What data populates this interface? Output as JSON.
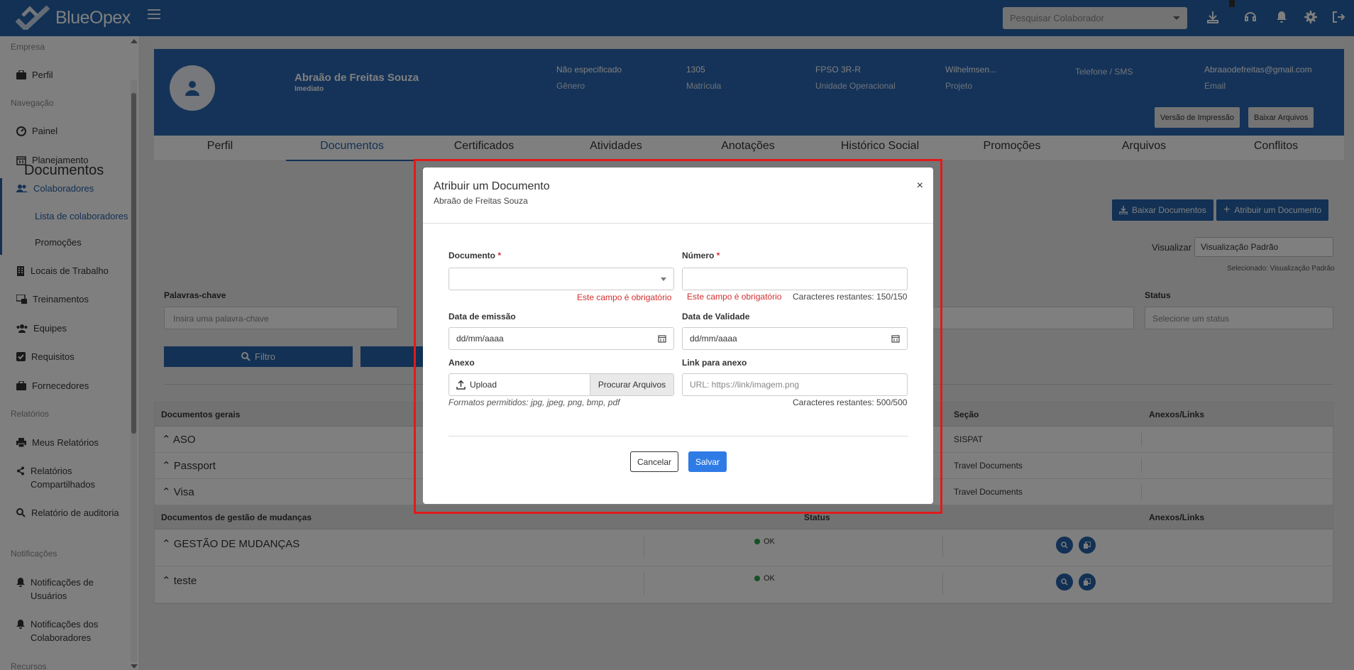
{
  "app": {
    "brand": "BlueOpex"
  },
  "topbar": {
    "search_placeholder": "Pesquisar Colaborador"
  },
  "sidebar": {
    "sections": {
      "empresa": "Empresa",
      "navegacao": "Navegação",
      "relatorios": "Relatórios",
      "notificacoes": "Notificações",
      "recursos": "Recursos"
    },
    "items": {
      "perfil": "Perfil",
      "painel": "Painel",
      "planejamento": "Planejamento",
      "colaboradores": "Colaboradores",
      "lista": "Lista de colaboradores",
      "promocoes": "Promoções",
      "locais": "Locais de Trabalho",
      "treinamentos": "Treinamentos",
      "equipes": "Equipes",
      "requisitos": "Requisitos",
      "fornecedores": "Fornecedores",
      "meus_relatorios": "Meus Relatórios",
      "relatorios_compartilhados": "Relatórios Compartilhados",
      "relatorio_auditoria": "Relatório de auditoria",
      "notif_usuarios": "Notificações de Usuários",
      "notif_colaboradores": "Notificações dos Colaboradores"
    }
  },
  "profile": {
    "name": "Abraão de Freitas Souza",
    "subtitle": "Imediato",
    "gender_value": "Não especificado",
    "gender_label": "Gênero",
    "matricula_value": "1305",
    "matricula_label": "Matrícula",
    "unit_value": "FPSO 3R-R",
    "unit_label": "Unidade Operacional",
    "project_value": "Wilhelmsen...",
    "project_label": "Projeto",
    "phone_label": "Telefone / SMS",
    "email_value": "Abraaodefreitas@gmail.com",
    "email_label": "Email",
    "print_btn": "Versão de Impressão",
    "download_btn": "Baixar Arquivos"
  },
  "tabs": [
    "Perfil",
    "Documentos",
    "Certificados",
    "Atividades",
    "Anotações",
    "Histórico Social",
    "Promoções",
    "Arquivos",
    "Conflitos"
  ],
  "documents": {
    "title": "Documentos",
    "download_btn": "Baixar Documentos",
    "assign_btn": "Atribuir um Documento",
    "visualizar_label": "Visualizar",
    "visualizar_value": "Visualização Padrão",
    "selected_note": "Selecionado: Visualização Padrão",
    "keywords_label": "Palavras-chave",
    "keywords_placeholder": "Insira uma palavra-chave",
    "status_label": "Status",
    "status_placeholder": "Selecione um status",
    "filter_btn": "Filtro"
  },
  "table1": {
    "headers": {
      "name": "Documentos gerais",
      "section": "Seção",
      "attachments": "Anexos/Links"
    },
    "rows": [
      {
        "name": "ASO",
        "section": "SISPAT"
      },
      {
        "name": "Passport",
        "section": "Travel Documents"
      },
      {
        "name": "Visa",
        "section": "Travel Documents"
      }
    ]
  },
  "table2": {
    "headers": {
      "name": "Documentos de gestão de mudanças",
      "status": "Status",
      "attachments": "Anexos/Links"
    },
    "rows": [
      {
        "name": "GESTÃO DE MUDANÇAS",
        "status": "OK"
      },
      {
        "name": "teste",
        "status": "OK"
      }
    ]
  },
  "modal": {
    "title": "Atribuir um Documento",
    "subtitle": "Abraão de Freitas Souza",
    "close": "×",
    "documento_label": "Documento",
    "numero_label": "Número",
    "required_mark": "*",
    "required_error": "Este campo é obrigatório",
    "chars_numero": "Caracteres restantes: 150/150",
    "emissao_label": "Data de emissão",
    "validade_label": "Data de Validade",
    "date_placeholder": "dd/mm/aaaa",
    "anexo_label": "Anexo",
    "upload_label": "Upload",
    "browse_label": "Procurar Arquivos",
    "formats_note": "Formatos permitidos: jpg, jpeg, png, bmp, pdf",
    "link_label": "Link para anexo",
    "link_placeholder": "URL: https://link/imagem.png",
    "chars_link": "Caracteres restantes: 500/500",
    "cancel_btn": "Cancelar",
    "save_btn": "Salvar"
  }
}
